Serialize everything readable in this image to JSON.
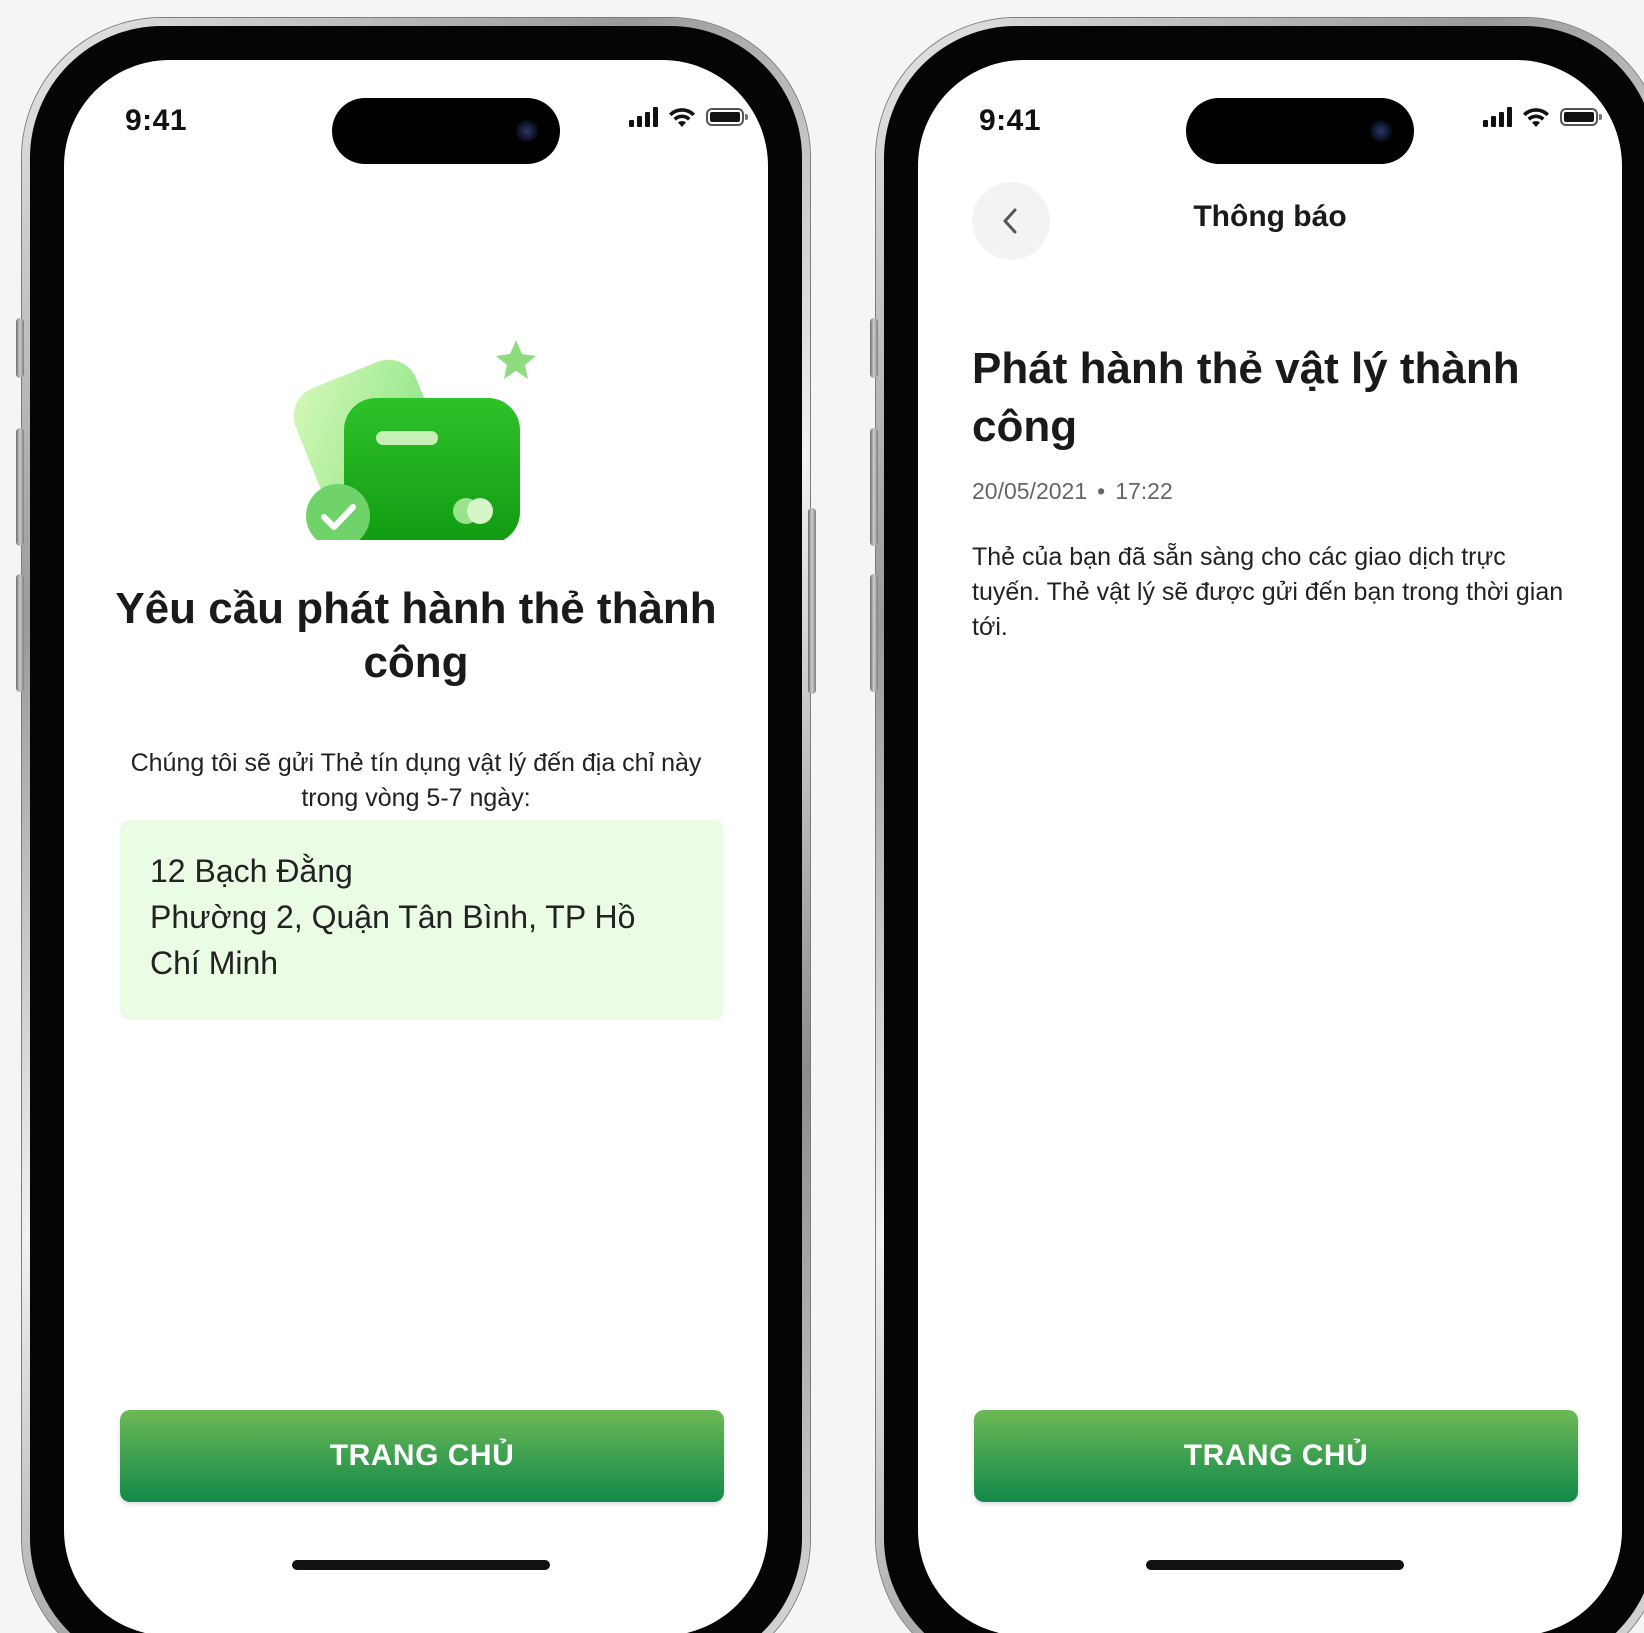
{
  "screen_success": {
    "status_time": "9:41",
    "title": "Yêu cầu phát hành thẻ thành công",
    "description": "Chúng tôi sẽ gửi Thẻ tín dụng vật lý đến địa chỉ này trong vòng 5-7 ngày:",
    "address": {
      "line1": "12 Bạch Đằng",
      "line2": "Phường 2, Quận Tân Bình, TP Hồ",
      "line3": "Chí Minh"
    },
    "button_label": "TRANG CHỦ"
  },
  "screen_notification": {
    "status_time": "9:41",
    "nav_title": "Thông báo",
    "title": "Phát hành thẻ vật lý thành công",
    "date": "20/05/2021",
    "time": "17:22",
    "body": "Thẻ của bạn đã sẵn sàng cho các giao dịch trực tuyến. Thẻ vật lý sẽ được gửi đến bạn trong thời gian tới.",
    "button_label": "TRANG CHỦ"
  },
  "colors": {
    "accent_green": "#1fae1a",
    "address_bg": "#eafce4",
    "button_top": "#6db954",
    "button_bottom": "#138a4a"
  },
  "icons": [
    "back-chevron-icon",
    "signal-icon",
    "wifi-icon",
    "battery-icon",
    "card-success-icon",
    "check-icon",
    "star-icon"
  ]
}
